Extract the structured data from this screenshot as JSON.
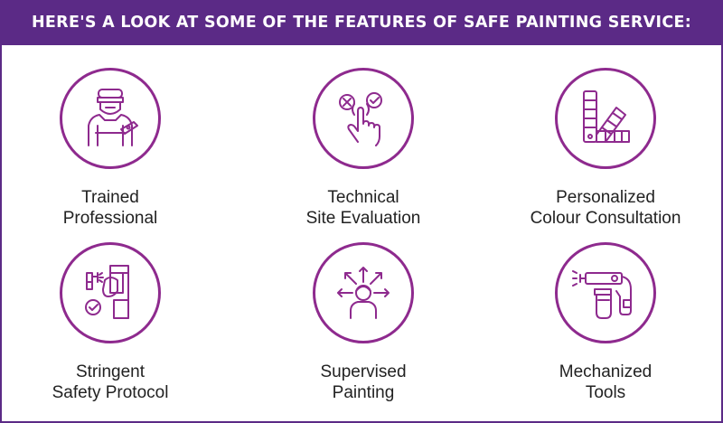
{
  "header": {
    "title": "HERE'S A LOOK AT SOME OF THE FEATURES OF SAFE PAINTING SERVICE:"
  },
  "colors": {
    "header_bg": "#5b2a86",
    "icon_stroke": "#8e2a8e",
    "text": "#222222"
  },
  "features": [
    {
      "icon": "trained-professional-icon",
      "line1": "Trained",
      "line2": "Professional"
    },
    {
      "icon": "site-evaluation-icon",
      "line1": "Technical",
      "line2": "Site Evaluation"
    },
    {
      "icon": "colour-swatch-icon",
      "line1": "Personalized",
      "line2": "Colour Consultation"
    },
    {
      "icon": "safety-protocol-icon",
      "line1": "Stringent",
      "line2": "Safety Protocol"
    },
    {
      "icon": "supervised-painting-icon",
      "line1": "Supervised",
      "line2": "Painting"
    },
    {
      "icon": "paint-sprayer-icon",
      "line1": "Mechanized",
      "line2": "Tools"
    }
  ]
}
